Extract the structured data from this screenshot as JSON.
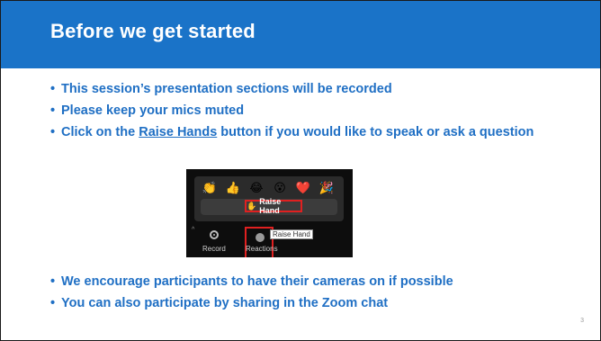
{
  "slide": {
    "title": "Before we get started",
    "bullets_top": [
      "This session’s presentation sections will be recorded",
      "Please keep your mics muted"
    ],
    "raise_bullet": {
      "prefix": "Click on the ",
      "link": "Raise Hands",
      "suffix": " button if you would like to speak or ask a question"
    },
    "bullets_bottom": [
      "We encourage participants to have their cameras on if possible",
      "You can also participate by sharing in the Zoom chat"
    ],
    "page_number": "3",
    "colors": {
      "title_bar": "#1a73c8",
      "bullet_text": "#1f6fc4",
      "highlight": "#e02020"
    }
  },
  "zoom": {
    "emojis": [
      "👏",
      "👍",
      "😂",
      "😮",
      "❤️",
      "🎉"
    ],
    "raise_hand_label": "Raise Hand",
    "raise_hand_icon": "raised-hand-icon",
    "record_label": "Record",
    "reactions_label": "Reactions",
    "tooltip": "Raise Hand"
  }
}
